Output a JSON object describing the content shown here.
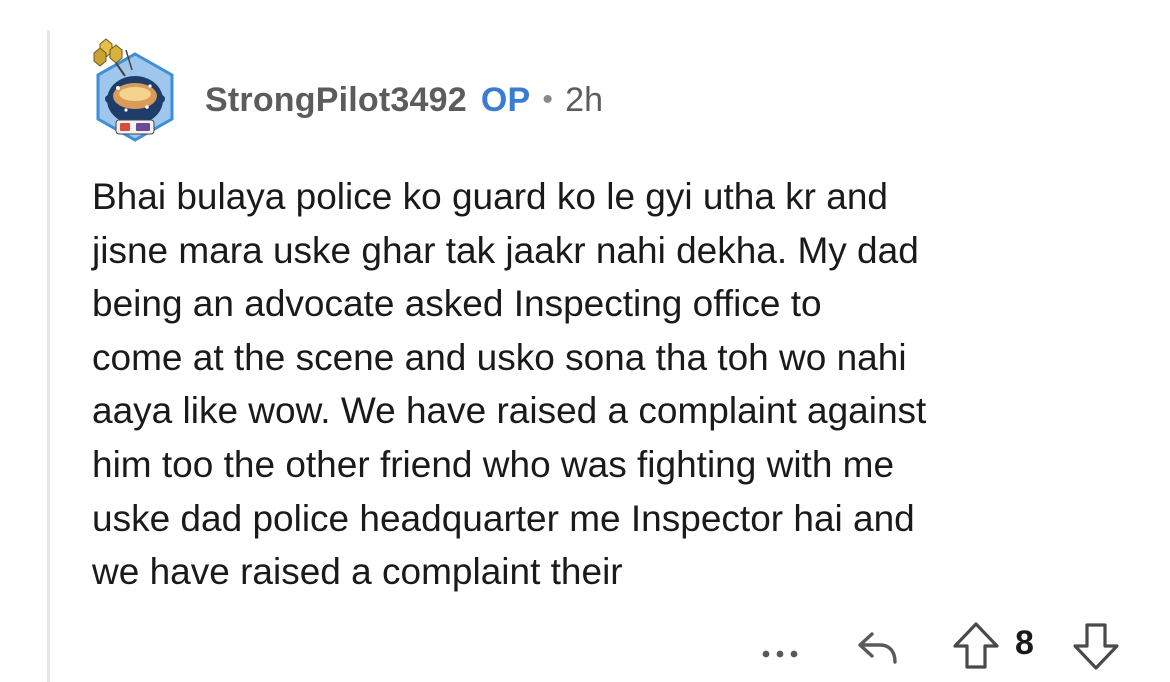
{
  "comment": {
    "username": "StrongPilot3492",
    "op_badge": "OP",
    "separator": "•",
    "time": "2h",
    "avatar_icon": "snoo-avatar-icon",
    "body": "Bhai bulaya police ko guard ko le gyi utha kr and\njisne mara uske ghar tak jaakr nahi dekha. My dad\nbeing an advocate asked Inspecting office to\ncome at the scene and usko sona tha toh wo nahi\naaya like wow. We have raised a complaint against\nhim too the other friend who was fighting with me\nuske dad police headquarter me Inspector hai and\nwe have raised a complaint their"
  },
  "actions": {
    "more_icon": "more-options-icon",
    "reply_icon": "reply-icon",
    "upvote_icon": "upvote-arrow-icon",
    "vote_count": "8",
    "downvote_icon": "downvote-arrow-icon"
  },
  "colors": {
    "op_accent": "#3a7bd5",
    "meta_text": "#5c5c5c",
    "body_text": "#1a1a1b",
    "thread_line": "#e6e6e6"
  }
}
